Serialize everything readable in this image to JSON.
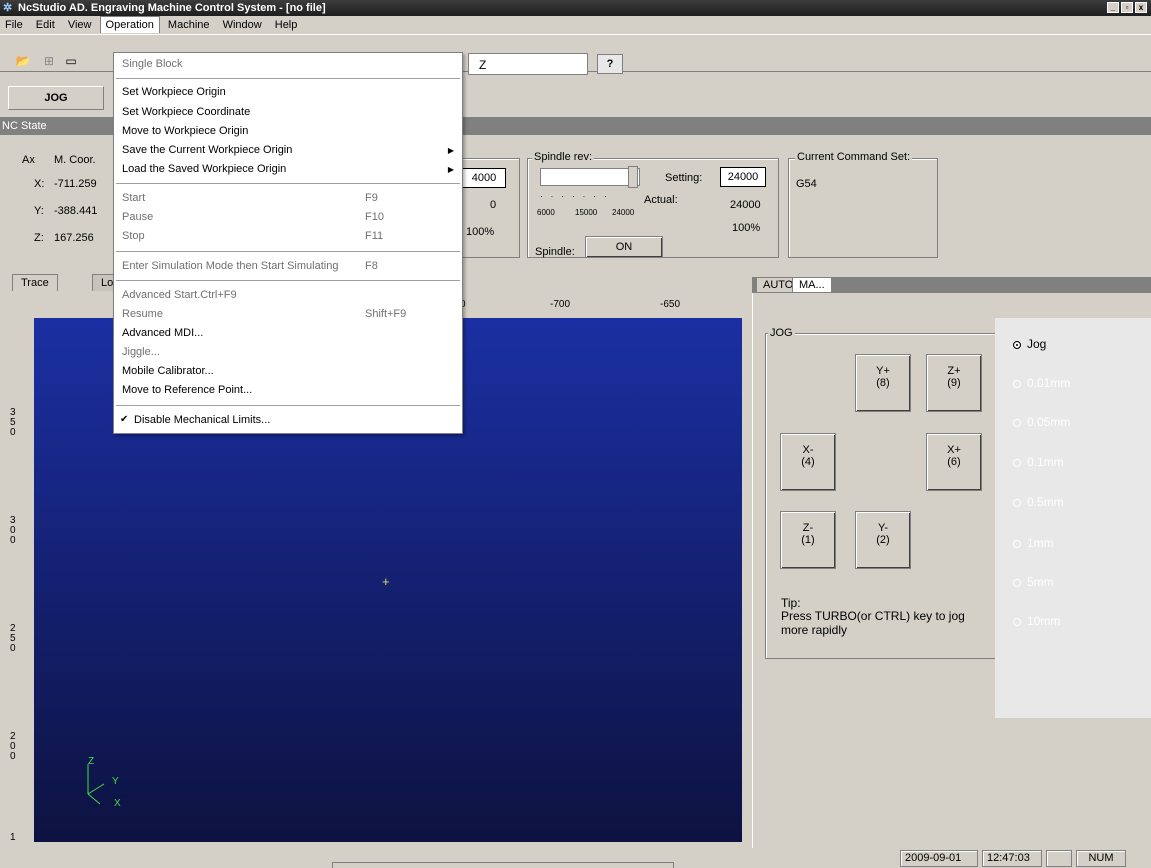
{
  "app": {
    "title": "NcStudio AD. Engraving Machine Control System  - [no file]",
    "window_buttons": [
      "_",
      "▫",
      "x"
    ]
  },
  "menubar": [
    "File",
    "Edit",
    "View",
    "Operation",
    "Machine",
    "Window",
    "Help"
  ],
  "toolbar": {
    "axis_field": "Z",
    "help_glyph": "?"
  },
  "mode_tab": "JOG",
  "nc_state": {
    "label": "NC State",
    "header": [
      "Ax",
      "M. Coor."
    ],
    "axes": [
      {
        "name": "X:",
        "value": "-711.259"
      },
      {
        "name": "Y:",
        "value": "-388.441"
      },
      {
        "name": "Z:",
        "value": "167.256"
      }
    ],
    "feed": {
      "setting": "4000",
      "actual": "0",
      "percent": "100%"
    },
    "spindle": {
      "label": "Spindle rev:",
      "setting_label": "Setting:",
      "setting": "24000",
      "actual_label": "Actual:",
      "actual": "24000",
      "percent": "100%",
      "scale": [
        "6000",
        "15000",
        "24000"
      ],
      "state_label": "Spindle:",
      "state_button": "ON"
    },
    "command_set": {
      "label": "Current Command Set:",
      "value": "G54"
    }
  },
  "trace_tabs": [
    "Trace",
    "Lo"
  ],
  "ruler": {
    "top": [
      "0",
      "-700",
      "-650"
    ],
    "left": [
      "3\n5\n0",
      "3\n0\n0",
      "2\n5\n0",
      "2\n0\n0",
      "1"
    ]
  },
  "axis_gizmo": {
    "z": "Z",
    "y": "Y",
    "x": "X"
  },
  "panel_tabs": [
    "AUTO",
    "MA..."
  ],
  "jog": {
    "label": "JOG",
    "buttons": [
      {
        "label": "Y+",
        "key": "(8)"
      },
      {
        "label": "Z+",
        "key": "(9)"
      },
      {
        "label": "X-",
        "key": "(4)"
      },
      {
        "label": "X+",
        "key": "(6)"
      },
      {
        "label": "Z-",
        "key": "(1)"
      },
      {
        "label": "Y-",
        "key": "(2)"
      }
    ],
    "tip_title": "Tip:",
    "tip_text": "Press TURBO(or CTRL) key to jog more rapidly",
    "steps": [
      "Jog",
      "0.01mm",
      "0.05mm",
      "0.1mm",
      "0.5mm",
      "1mm",
      "5mm",
      "10mm"
    ],
    "selected_step": "Jog"
  },
  "operation_menu": {
    "items": [
      {
        "label": "Single Block",
        "disabled": true
      },
      {
        "label": "Set Workpiece Origin"
      },
      {
        "label": "Set Workpiece Coordinate"
      },
      {
        "label": "Move to Workpiece Origin"
      },
      {
        "label": "Save the Current Workpiece Origin",
        "submenu": true
      },
      {
        "label": "Load the Saved Workpiece Origin",
        "submenu": true
      },
      {
        "label": "Start",
        "shortcut": "F9",
        "disabled": true
      },
      {
        "label": "Pause",
        "shortcut": "F10",
        "disabled": true
      },
      {
        "label": "Stop",
        "shortcut": "F11",
        "disabled": true
      },
      {
        "label": "Enter Simulation Mode then Start Simulating",
        "shortcut": "F8",
        "disabled": true
      },
      {
        "label": "Advanced Start.Ctrl+F9",
        "disabled": true
      },
      {
        "label": "Resume",
        "shortcut": "Shift+F9",
        "disabled": true
      },
      {
        "label": "Advanced MDI..."
      },
      {
        "label": "Jiggle...",
        "disabled": true
      },
      {
        "label": "Mobile Calibrator..."
      },
      {
        "label": "Move to Reference Point..."
      },
      {
        "label": "Disable Mechanical Limits...",
        "checked": true
      }
    ]
  },
  "statusbar": {
    "date": "2009-09-01",
    "time": "12:47:03",
    "num": "NUM"
  },
  "colors": {
    "canvas_top": "#1b2fa3",
    "canvas_bottom": "#0d1240",
    "chrome": "#d4d0c8"
  }
}
